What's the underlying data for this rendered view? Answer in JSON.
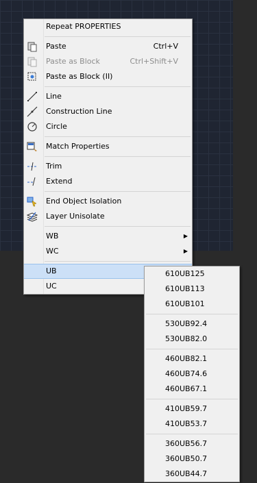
{
  "context_menu": {
    "repeat": "Repeat PROPERTIES",
    "paste": {
      "label": "Paste",
      "shortcut": "Ctrl+V"
    },
    "paste_as_block": {
      "label": "Paste as Block",
      "shortcut": "Ctrl+Shift+V"
    },
    "paste_as_block_ii": "Paste as Block (II)",
    "line": "Line",
    "construction_line": "Construction Line",
    "circle": "Circle",
    "match_properties": "Match Properties",
    "trim": "Trim",
    "extend": "Extend",
    "end_object_isolation": "End Object Isolation",
    "layer_unisolate": "Layer Unisolate",
    "wb": "WB",
    "wc": "WC",
    "ub": "UB",
    "uc": "UC",
    "submenu_arrow": "▶"
  },
  "ub_submenu": {
    "groups": [
      [
        "610UB125",
        "610UB113",
        "610UB101"
      ],
      [
        "530UB92.4",
        "530UB82.0"
      ],
      [
        "460UB82.1",
        "460UB74.6",
        "460UB67.1"
      ],
      [
        "410UB59.7",
        "410UB53.7"
      ],
      [
        "360UB56.7",
        "360UB50.7",
        "360UB44.7"
      ]
    ]
  },
  "colors": {
    "canvas": "#1f2532",
    "menu_background": "#f0f0f0",
    "highlight": "#cce0f7",
    "disabled_text": "#8d8d8d"
  }
}
